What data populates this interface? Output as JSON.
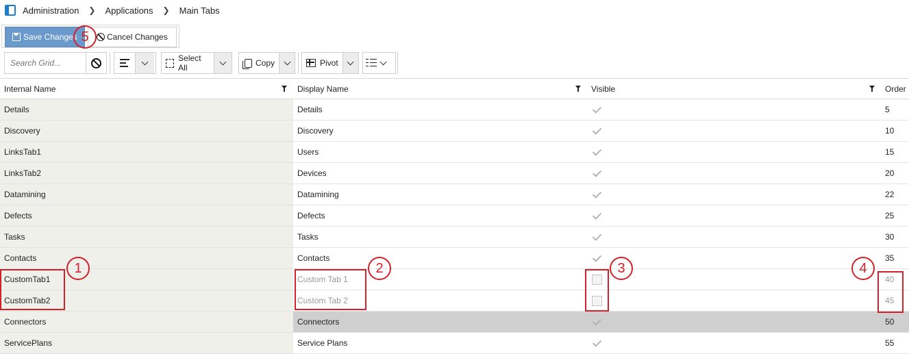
{
  "breadcrumb": {
    "items": [
      "Administration",
      "Applications",
      "Main Tabs"
    ]
  },
  "actions": {
    "save_label": "Save Changes",
    "cancel_label": "Cancel Changes"
  },
  "toolbar": {
    "search_placeholder": "Search Grid...",
    "select_all_label": "Select All",
    "copy_label": "Copy",
    "pivot_label": "Pivot"
  },
  "grid": {
    "columns": [
      "Internal Name",
      "Display Name",
      "Visible",
      "Order"
    ],
    "rows": [
      {
        "internal": "Details",
        "display": "Details",
        "visible": true,
        "order": "5"
      },
      {
        "internal": "Discovery",
        "display": "Discovery",
        "visible": true,
        "order": "10"
      },
      {
        "internal": "LinksTab1",
        "display": "Users",
        "visible": true,
        "order": "15"
      },
      {
        "internal": "LinksTab2",
        "display": "Devices",
        "visible": true,
        "order": "20"
      },
      {
        "internal": "Datamining",
        "display": "Datamining",
        "visible": true,
        "order": "22"
      },
      {
        "internal": "Defects",
        "display": "Defects",
        "visible": true,
        "order": "25"
      },
      {
        "internal": "Tasks",
        "display": "Tasks",
        "visible": true,
        "order": "30"
      },
      {
        "internal": "Contacts",
        "display": "Contacts",
        "visible": true,
        "order": "35"
      },
      {
        "internal": "CustomTab1",
        "display": "Custom Tab 1",
        "visible": false,
        "order": "40"
      },
      {
        "internal": "CustomTab2",
        "display": "Custom Tab 2",
        "visible": false,
        "order": "45"
      },
      {
        "internal": "Connectors",
        "display": "Connectors",
        "visible": true,
        "order": "50"
      },
      {
        "internal": "ServicePlans",
        "display": "Service Plans",
        "visible": true,
        "order": "55"
      }
    ]
  },
  "annotations": {
    "markers": [
      "1",
      "2",
      "3",
      "4",
      "5"
    ],
    "color": "#d4202a"
  }
}
